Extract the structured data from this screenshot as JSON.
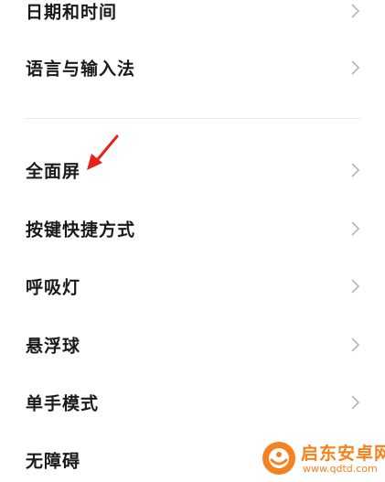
{
  "settings": {
    "items": [
      {
        "label": "日期和时间"
      },
      {
        "label": "语言与输入法"
      },
      {
        "label": "全面屏"
      },
      {
        "label": "按键快捷方式"
      },
      {
        "label": "呼吸灯"
      },
      {
        "label": "悬浮球"
      },
      {
        "label": "单手模式"
      },
      {
        "label": "无障碍"
      }
    ]
  },
  "annotation": {
    "color": "#e8221b",
    "icon": "red-arrow-icon"
  },
  "watermark": {
    "text": "启东安卓网",
    "url": "www.qdtd.com",
    "color": "#f58220"
  },
  "icons": {
    "chevron": "chevron-right-icon"
  }
}
